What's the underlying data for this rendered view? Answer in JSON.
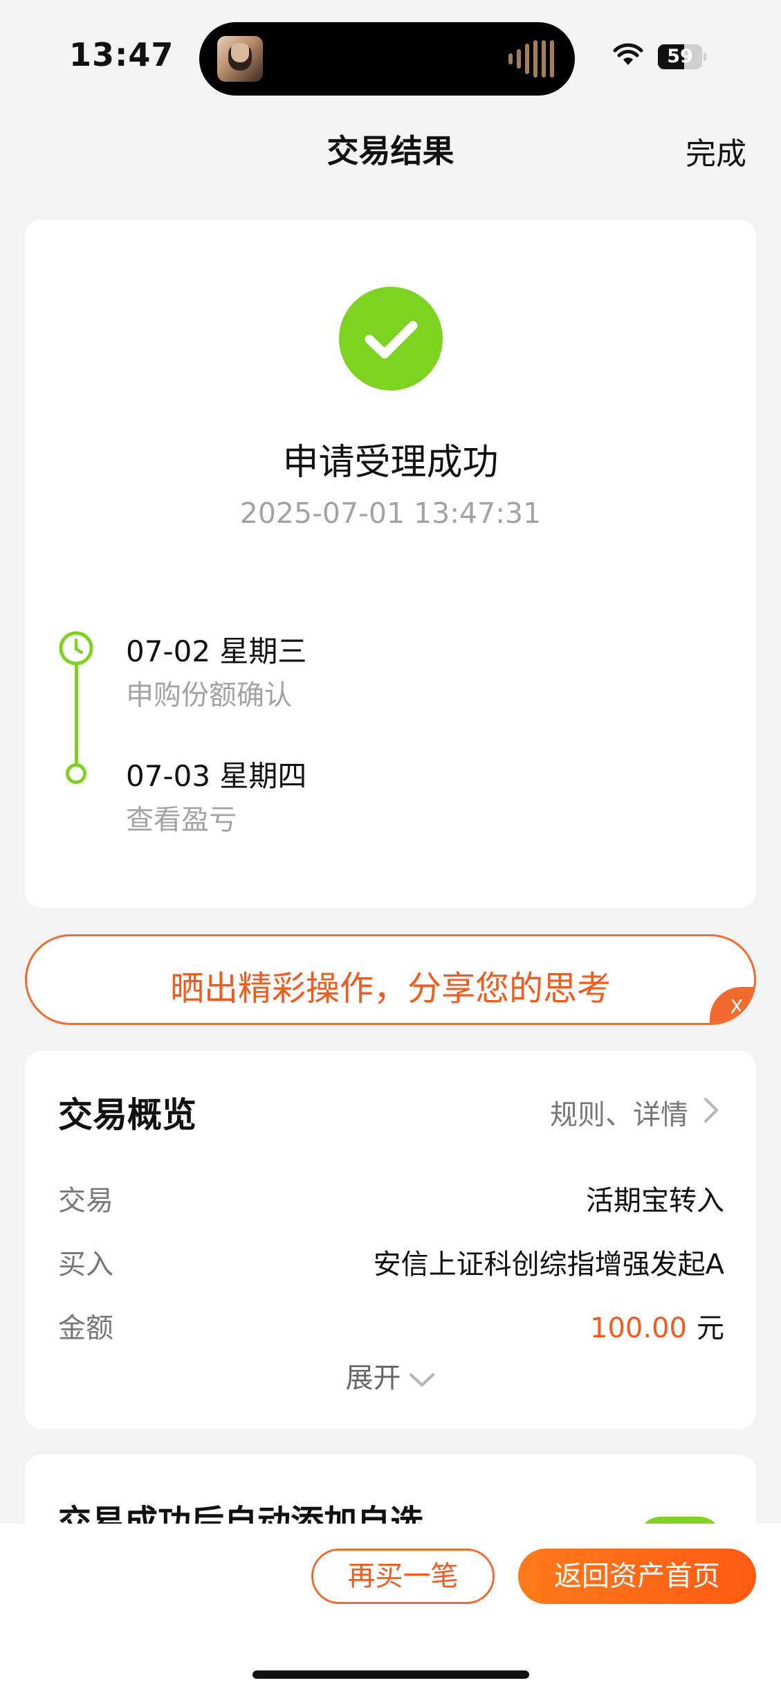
{
  "status_bar": {
    "time": "13:47",
    "battery": "59"
  },
  "nav": {
    "title": "交易结果",
    "done": "完成"
  },
  "result": {
    "title": "申请受理成功",
    "time": "2025-07-01 13:47:31",
    "timeline": [
      {
        "date": "07-02  星期三",
        "desc": "申购份额确认"
      },
      {
        "date": "07-03  星期四",
        "desc": "查看盈亏"
      }
    ]
  },
  "share": {
    "text": "晒出精彩操作，分享您的思考",
    "close": "X"
  },
  "overview": {
    "title": "交易概览",
    "link": "规则、详情",
    "rows": [
      {
        "label": "交易",
        "value": "活期宝转入"
      },
      {
        "label": "买入",
        "value": "安信上证科创综指增强发起A"
      },
      {
        "label": "金额",
        "value": "100.00",
        "unit": "元"
      }
    ],
    "expand": "展开"
  },
  "auto_add": {
    "title": "交易成功后自动添加自选",
    "enabled": true
  },
  "actions": {
    "buy_again": "再买一笔",
    "back_home": "返回资产首页"
  },
  "colors": {
    "accent": "#f25a1e",
    "success": "#7ed321"
  }
}
